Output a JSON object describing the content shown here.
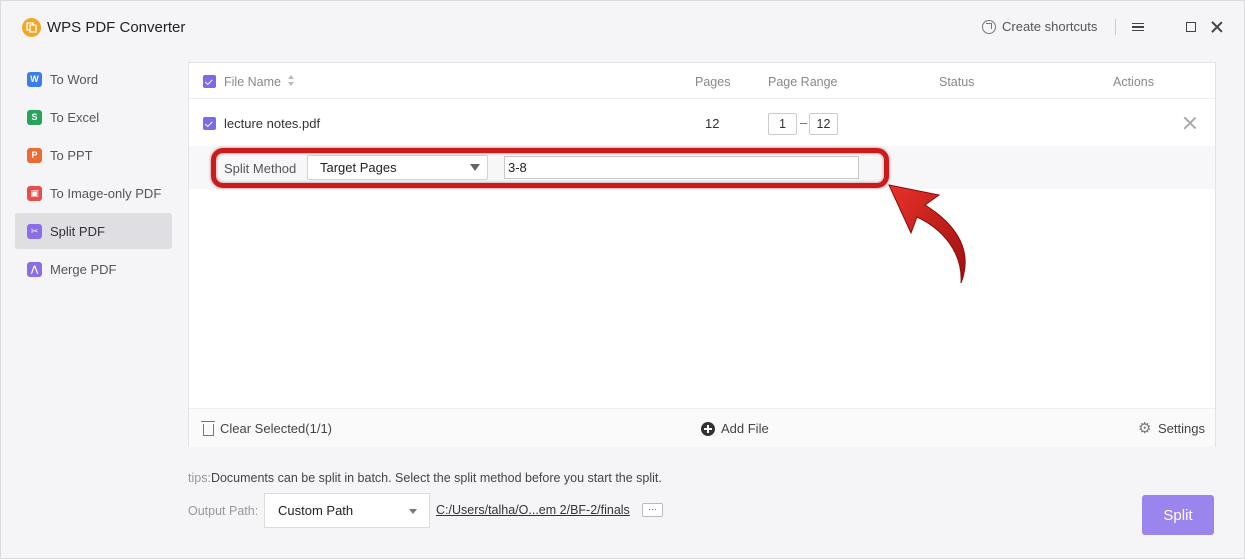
{
  "app": {
    "title": "WPS PDF Converter",
    "create_shortcuts": "Create shortcuts"
  },
  "sidebar": {
    "items": [
      {
        "label": "To Word",
        "icon": "W",
        "color": "#3b7de9",
        "active": false
      },
      {
        "label": "To Excel",
        "icon": "S",
        "color": "#27a35a",
        "active": false
      },
      {
        "label": "To PPT",
        "icon": "P",
        "color": "#ec6a34",
        "active": false
      },
      {
        "label": "To Image-only PDF",
        "icon": "▣",
        "color": "#e84c4c",
        "active": false
      },
      {
        "label": "Split PDF",
        "icon": "✂",
        "color": "#8a6ee8",
        "active": true
      },
      {
        "label": "Merge PDF",
        "icon": "⋀",
        "color": "#8a6ee8",
        "active": false
      }
    ]
  },
  "table": {
    "headers": {
      "file_name": "File Name",
      "pages": "Pages",
      "page_range": "Page Range",
      "status": "Status",
      "actions": "Actions"
    },
    "rows": [
      {
        "file_name": "lecture notes.pdf",
        "pages": "12",
        "range_from": "1",
        "range_to": "12",
        "range_sep": "–"
      }
    ]
  },
  "split": {
    "label": "Split Method",
    "method": "Target Pages",
    "pages_value": "3-8"
  },
  "footer": {
    "clear_selected": "Clear Selected(1/1)",
    "add_file": "Add File",
    "settings": "Settings"
  },
  "tips": {
    "label": "tips:",
    "text": "Documents can be split in batch. Select the split method before you start the split."
  },
  "output": {
    "label": "Output Path:",
    "mode": "Custom Path",
    "path": "C:/Users/talha/O...em 2/BF-2/finals",
    "browse": "···"
  },
  "actions": {
    "split_label": "Split"
  },
  "colors": {
    "accent": "#7b6be6",
    "split_button": "#9a85ee",
    "annotation_red": "#cc1a1a"
  }
}
